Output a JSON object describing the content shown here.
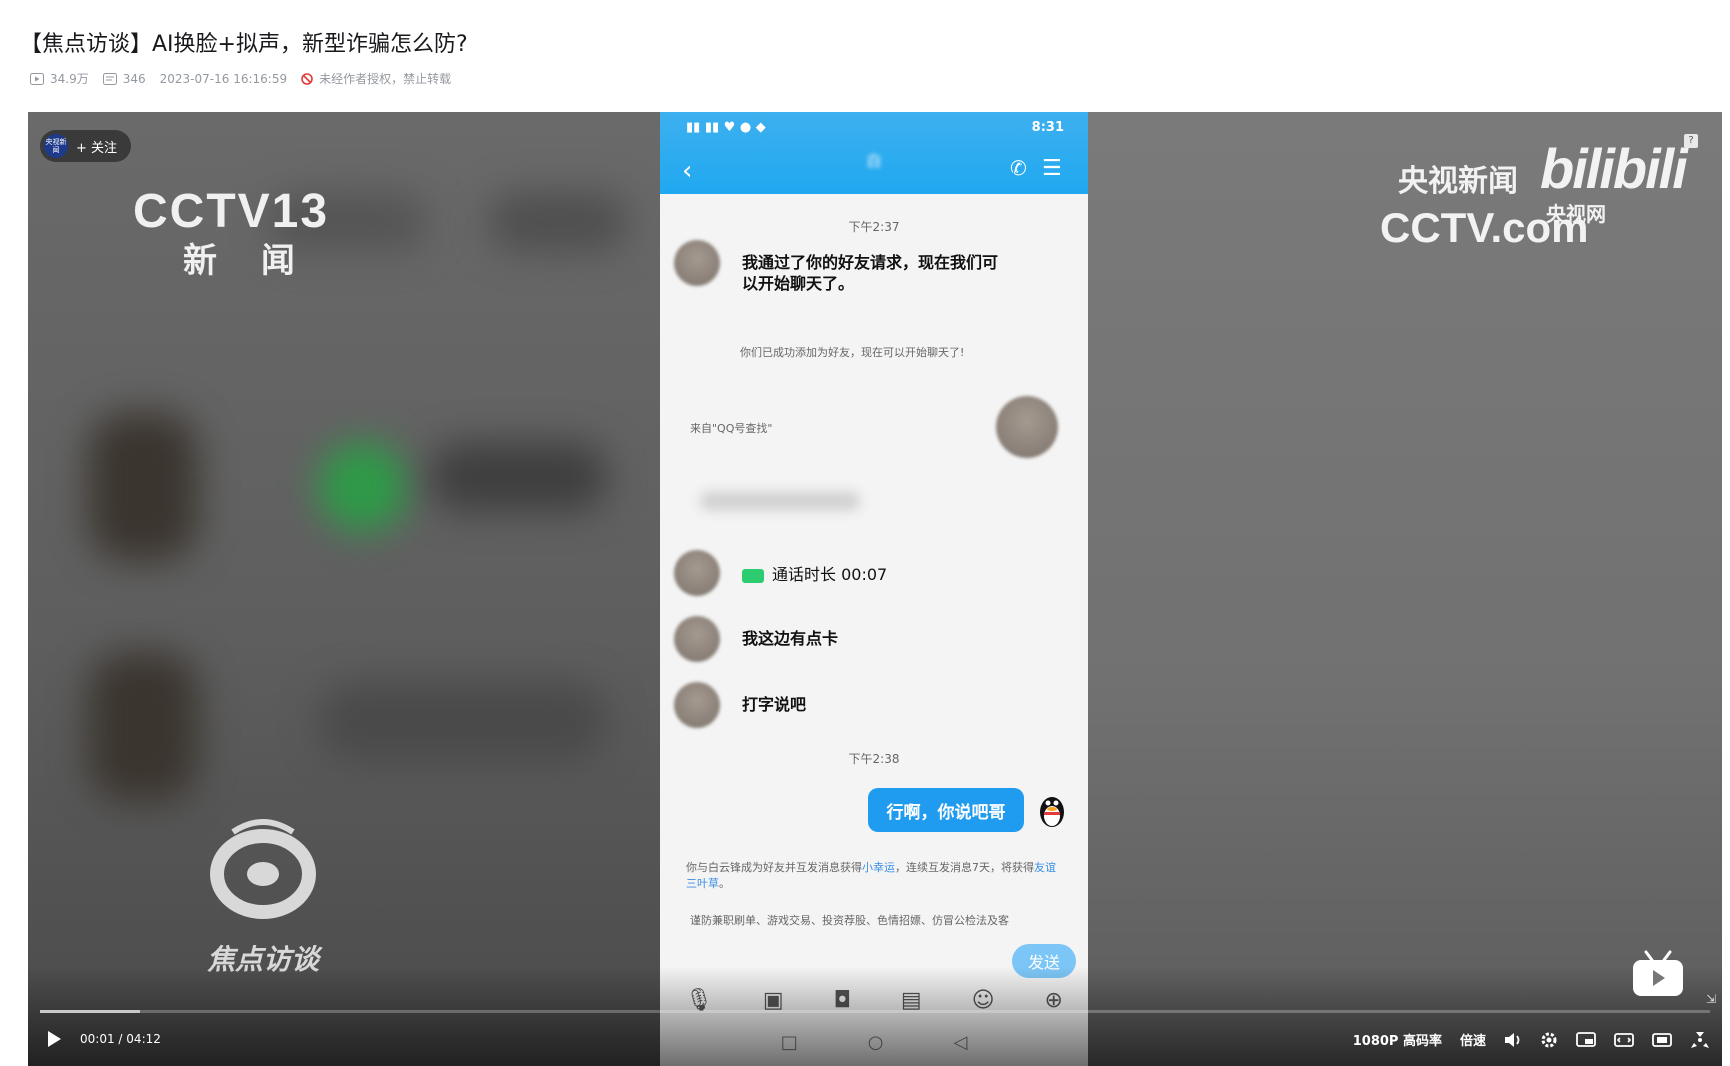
{
  "page": {
    "title": "【焦点访谈】AI换脸+拟声，新型诈骗怎么防?",
    "stats": {
      "plays": "34.9万",
      "danmaku": "346",
      "datetime": "2023-07-16 16:16:59",
      "copyright_note": "未经作者授权，禁止转载"
    }
  },
  "player": {
    "follow_label": "+ 关注",
    "channel_logo_text": "央视新闻",
    "watermark_left_top": "CCTV13",
    "watermark_left_top_sub": "新 闻",
    "watermark_left_bottom": "焦点访谈",
    "watermark_right_cn": "央视新闻",
    "watermark_right_bili": "bilibili",
    "watermark_right_cctvcom": "CCTV.com",
    "watermark_right_site": "央视网",
    "help_icon": "?",
    "time_current": "00:01",
    "time_separator": "/",
    "time_total": "04:12",
    "progress_fraction": 0.06,
    "quality_label": "1080P 高码率",
    "speed_label": "倍速"
  },
  "phone": {
    "status_time": "8:31",
    "contact_name": "白",
    "time_1": "下午2:37",
    "msg_1": "我通过了你的好友请求，现在我们可以开始聊天了。",
    "sys_1": "你们已成功添加为好友，现在可以开始聊天了!",
    "source_note": "来自\"QQ号查找\"",
    "call_duration": "通话时长 00:07",
    "msg_2": "我这边有点卡",
    "msg_3": "打字说吧",
    "time_2": "下午2:38",
    "my_msg": "行啊，你说吧哥",
    "sys_2_prefix": "你与白云锋成为好友并互发消息获得",
    "sys_2_link1": "小幸运",
    "sys_2_mid": "，连续互发消息7天，将获得",
    "sys_2_link2": "友谊三叶草",
    "sys_2_end": "。",
    "warning_line": "谨防兼职刷单、游戏交易、投资荐股、色情招嫖、仿冒公检法及客",
    "send_button": "发送"
  }
}
